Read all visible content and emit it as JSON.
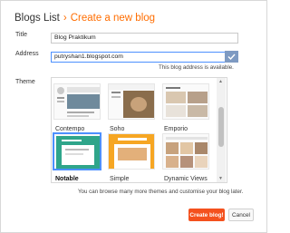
{
  "header": {
    "section": "Blogs List",
    "separator": "›",
    "current": "Create a new blog"
  },
  "form": {
    "title_label": "Title",
    "title_value": "Blog Praktikum",
    "address_label": "Address",
    "address_value": "putryshan1.blogspot.com",
    "address_status": "This blog address is available.",
    "theme_label": "Theme"
  },
  "themes": [
    {
      "name": "Contempo",
      "selected": false
    },
    {
      "name": "Soho",
      "selected": false
    },
    {
      "name": "Emporio",
      "selected": false
    },
    {
      "name": "Notable",
      "selected": true
    },
    {
      "name": "Simple",
      "selected": false
    },
    {
      "name": "Dynamic Views",
      "selected": false
    }
  ],
  "footer": {
    "note": "You can browse many more themes and customise your blog later.",
    "create_label": "Create blog!",
    "cancel_label": "Cancel"
  },
  "colors": {
    "accent": "#ff6d00",
    "primary_button": "#f4511e",
    "focus_border": "#4d90fe"
  },
  "icons": {
    "address_check": "check-icon"
  }
}
